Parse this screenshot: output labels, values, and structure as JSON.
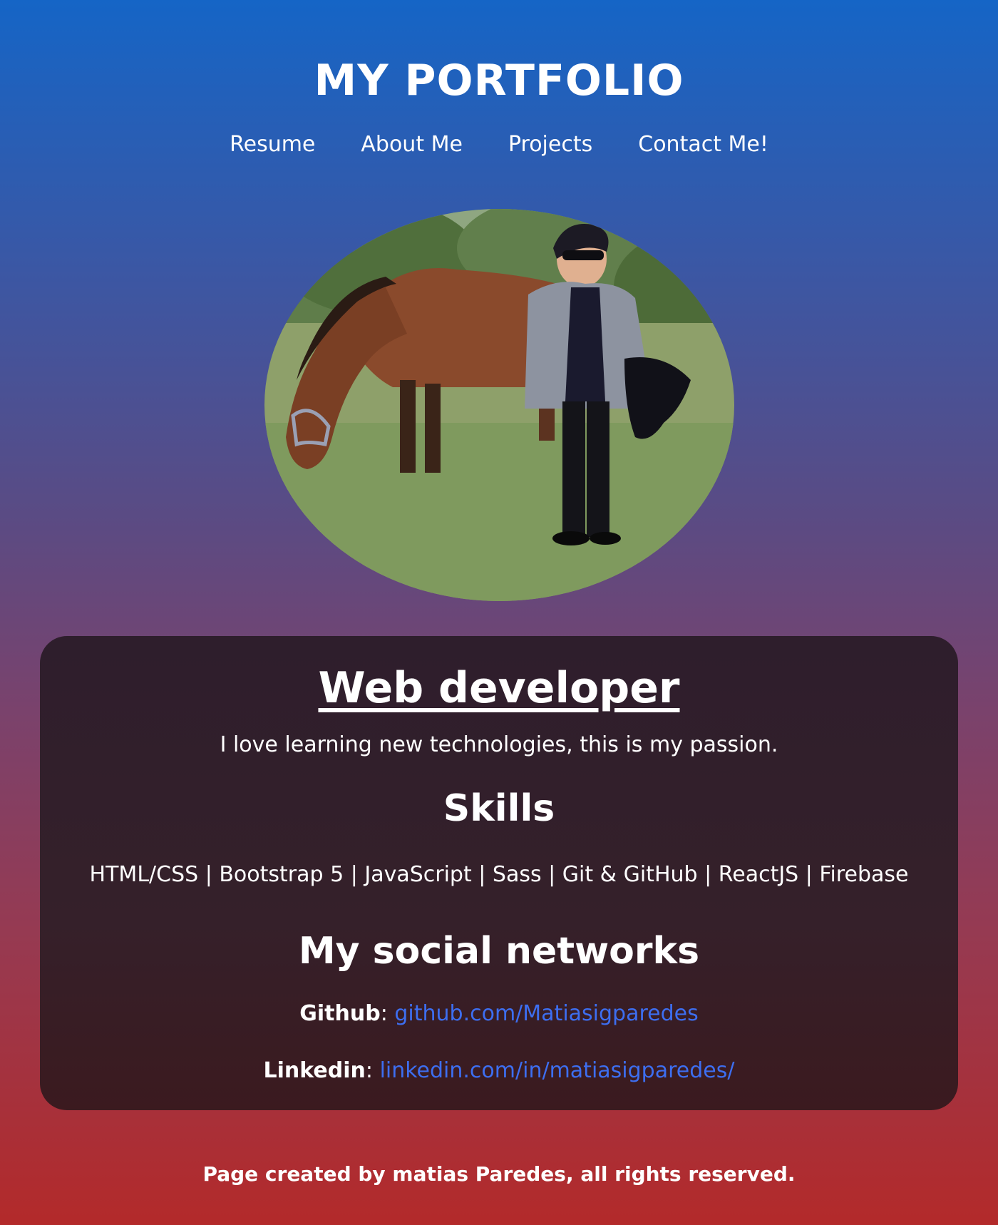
{
  "header": {
    "title": "MY PORTFOLIO"
  },
  "nav": {
    "items": [
      {
        "label": "Resume"
      },
      {
        "label": "About Me"
      },
      {
        "label": "Projects"
      },
      {
        "label": "Contact Me!"
      }
    ]
  },
  "profile": {
    "role": "Web developer",
    "tagline": "I love learning new technologies, this is my passion."
  },
  "skills": {
    "title": "Skills",
    "list": "HTML/CSS | Bootstrap 5 | JavaScript | Sass | Git & GitHub | ReactJS | Firebase"
  },
  "social": {
    "title": "My social networks",
    "networks": [
      {
        "label": "Github",
        "separator": ":",
        "link": "github.com/Matiasigparedes"
      },
      {
        "label": "Linkedin",
        "separator": ":",
        "link": "linkedin.com/in/matiasigparedes/"
      }
    ]
  },
  "footer": {
    "text": "Page created by matias Paredes, all rights reserved."
  },
  "colors": {
    "link": "#3d6ef0",
    "card_background": "#321e29",
    "gradient_top": "#1565c6",
    "gradient_bottom": "#b32a2a"
  }
}
